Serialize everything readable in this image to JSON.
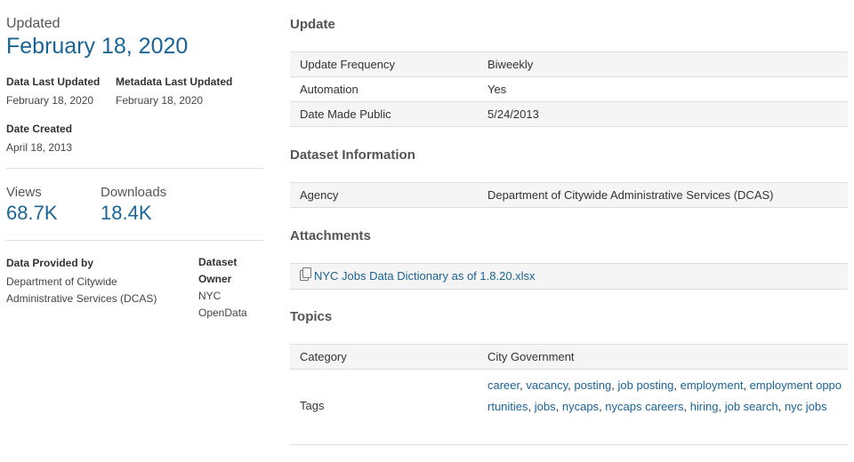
{
  "summary": {
    "updated_label": "Updated",
    "updated_date": "February 18, 2020",
    "data_last_updated_label": "Data Last Updated",
    "data_last_updated_value": "February 18, 2020",
    "metadata_last_updated_label": "Metadata Last Updated",
    "metadata_last_updated_value": "February 18, 2020",
    "date_created_label": "Date Created",
    "date_created_value": "April 18, 2013",
    "views_label": "Views",
    "views_value": "68.7K",
    "downloads_label": "Downloads",
    "downloads_value": "18.4K",
    "provided_by_label": "Data Provided by",
    "provided_by_value": "Department of Citywide Administrative Services (DCAS)",
    "owner_label": "Dataset Owner",
    "owner_value": "NYC OpenData"
  },
  "update": {
    "title": "Update",
    "rows": [
      {
        "key": "Update Frequency",
        "value": "Biweekly"
      },
      {
        "key": "Automation",
        "value": "Yes"
      },
      {
        "key": "Date Made Public",
        "value": "5/24/2013"
      }
    ]
  },
  "dataset_info": {
    "title": "Dataset Information",
    "rows": [
      {
        "key": "Agency",
        "value": "Department of Citywide Administrative Services (DCAS)"
      }
    ]
  },
  "attachments": {
    "title": "Attachments",
    "file_icon": "file-copy-icon",
    "file_name": "NYC Jobs Data Dictionary as of 1.8.20.xlsx"
  },
  "topics": {
    "title": "Topics",
    "category_label": "Category",
    "category_value": "City Government",
    "tags_label": "Tags",
    "tags": [
      "career",
      "vacancy",
      "posting",
      "job posting",
      "employment",
      "employment opportunities",
      "jobs",
      "nycaps",
      "nycaps careers",
      "hiring",
      "job search",
      "nyc jobs"
    ]
  },
  "colors": {
    "link": "#1a6496",
    "row_shade": "#f5f5f5",
    "divider": "#dddddd"
  }
}
